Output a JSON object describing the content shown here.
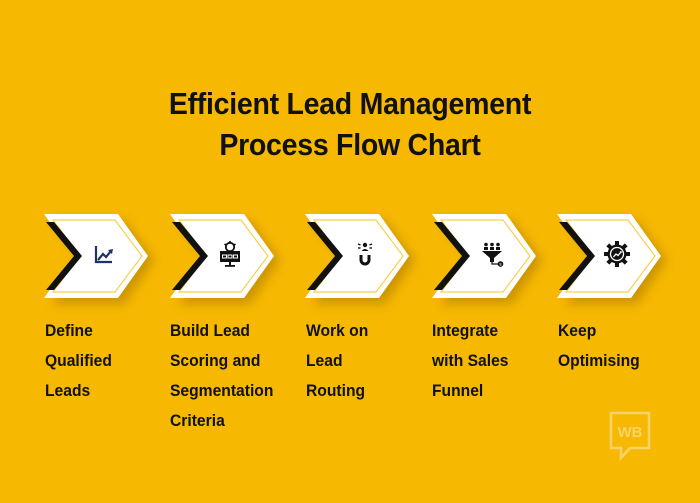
{
  "title": {
    "line1": "Efficient Lead Management",
    "line2": "Process Flow Chart"
  },
  "colors": {
    "background": "#F6B800",
    "chevron_fill": "#FFFFFF",
    "chevron_outline": "#F6D04D",
    "accent_black": "#111111",
    "icon_navy": "#1F3462",
    "text": "#111111",
    "logo": "#F9D36A"
  },
  "steps": [
    {
      "order": 1,
      "icon": "growth-chart-icon",
      "lines": [
        "Define",
        "Qualified",
        "Leads"
      ]
    },
    {
      "order": 2,
      "icon": "monitor-gear-icon",
      "lines": [
        "Build Lead",
        "Scoring and",
        "Segmentation",
        "Criteria"
      ]
    },
    {
      "order": 3,
      "icon": "magnet-person-icon",
      "lines": [
        "Work on",
        "Lead",
        "Routing"
      ]
    },
    {
      "order": 4,
      "icon": "sales-funnel-icon",
      "lines": [
        "Integrate",
        "with Sales",
        "Funnel"
      ]
    },
    {
      "order": 5,
      "icon": "gear-growth-icon",
      "lines": [
        "Keep",
        "Optimising"
      ]
    }
  ],
  "logo": {
    "text": "WB"
  }
}
